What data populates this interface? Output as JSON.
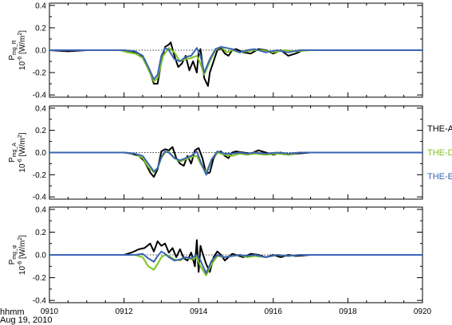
{
  "chart_data": {
    "type": "line",
    "shared_x": {
      "domain": [
        910,
        920
      ],
      "ticks": [
        910,
        912,
        914,
        916,
        918,
        920
      ],
      "tick_labels": [
        "0910",
        "0912",
        "0914",
        "0916",
        "0918",
        "0920"
      ],
      "corner_label_line1": "hhmm",
      "corner_label_line2": "Aug 19, 2010"
    },
    "legend": [
      {
        "name": "THE-A",
        "color": "#000000"
      },
      {
        "name": "THE-D",
        "color": "#7fc31c"
      },
      {
        "name": "THE-E",
        "color": "#3b64b4"
      }
    ],
    "panels": [
      {
        "ylabel_main": "P",
        "ylabel_sub": "mg_R",
        "yunit": "10",
        "yunit_exp": "-6",
        "yunit_rest": "[W/m",
        "yunit_sq": "2",
        "yunit_end": "]",
        "ylim": [
          -0.42,
          0.42
        ],
        "yticks": [
          -0.4,
          -0.2,
          0.0,
          0.2,
          0.4
        ],
        "ytick_labels": [
          "-0.4",
          "-0.2",
          "0.0",
          "0.2",
          "0.4"
        ],
        "series": [
          {
            "name": "THE-A",
            "x": [
              910,
              910.5,
              911,
              911.5,
              912,
              912.2,
              912.4,
              912.55,
              912.7,
              912.8,
              912.9,
              913,
              913.1,
              913.2,
              913.25,
              913.35,
              913.45,
              913.55,
              913.65,
              913.75,
              913.85,
              913.95,
              914,
              914.05,
              914.15,
              914.25,
              914.3,
              914.4,
              914.5,
              914.6,
              914.7,
              914.8,
              914.9,
              915,
              915.2,
              915.4,
              915.6,
              915.8,
              916,
              916.2,
              916.4,
              916.6,
              916.8,
              917,
              917.5,
              918,
              918.5,
              919,
              919.5,
              920
            ],
            "y": [
              0,
              -0.01,
              0,
              0,
              0,
              -0.01,
              -0.03,
              -0.08,
              -0.2,
              -0.3,
              -0.3,
              -0.1,
              0.03,
              0.05,
              0.07,
              -0.05,
              -0.15,
              -0.12,
              -0.05,
              -0.18,
              -0.1,
              -0.2,
              -0.02,
              0.01,
              -0.25,
              -0.32,
              -0.2,
              -0.1,
              0,
              0.02,
              -0.03,
              -0.05,
              0,
              0.01,
              -0.02,
              -0.03,
              0.01,
              0,
              -0.03,
              0,
              -0.05,
              -0.03,
              0,
              0,
              0,
              0,
              0,
              0,
              0,
              0
            ]
          },
          {
            "name": "THE-D",
            "x": [
              910,
              910.5,
              911,
              911.5,
              911.9,
              912.1,
              912.3,
              912.5,
              912.65,
              912.8,
              912.9,
              913.05,
              913.2,
              913.35,
              913.5,
              913.65,
              913.8,
              913.95,
              914.05,
              914.15,
              914.3,
              914.45,
              914.6,
              914.75,
              914.9,
              915.1,
              915.3,
              915.5,
              915.7,
              916,
              916.3,
              916.6,
              917,
              917.5,
              918,
              918.5,
              919,
              919.5,
              920
            ],
            "y": [
              0,
              0,
              0,
              0,
              0,
              -0.02,
              -0.03,
              -0.07,
              -0.17,
              -0.28,
              -0.25,
              -0.05,
              0.02,
              -0.02,
              -0.1,
              -0.08,
              -0.07,
              -0.05,
              -0.12,
              -0.22,
              -0.1,
              0,
              0.03,
              -0.02,
              0,
              -0.02,
              -0.01,
              0,
              0,
              -0.02,
              0,
              -0.01,
              0,
              0,
              0,
              0,
              0,
              0,
              0
            ]
          },
          {
            "name": "THE-E",
            "x": [
              910,
              910.5,
              911,
              911.5,
              912,
              912.3,
              912.5,
              912.65,
              912.8,
              912.9,
              913,
              913.1,
              913.2,
              913.35,
              913.5,
              913.65,
              913.8,
              913.95,
              914.05,
              914.15,
              914.3,
              914.45,
              914.6,
              914.75,
              914.9,
              915.1,
              915.3,
              915.5,
              915.8,
              916.1,
              916.4,
              916.7,
              917,
              917.5,
              918,
              918.5,
              919,
              919.5,
              920
            ],
            "y": [
              0,
              0,
              0,
              0,
              0,
              -0.01,
              -0.05,
              -0.15,
              -0.26,
              -0.22,
              -0.05,
              0.02,
              0,
              -0.08,
              -0.1,
              -0.06,
              -0.05,
              0.02,
              -0.05,
              -0.2,
              -0.08,
              0.01,
              0.03,
              0.02,
              0.01,
              -0.02,
              0,
              0.01,
              -0.02,
              0,
              -0.02,
              0,
              0,
              0,
              0,
              0,
              0,
              0,
              0
            ]
          }
        ]
      },
      {
        "ylabel_main": "P",
        "ylabel_sub": "mg_A",
        "yunit": "10",
        "yunit_exp": "-6",
        "yunit_rest": "[W/m",
        "yunit_sq": "2",
        "yunit_end": "]",
        "ylim": [
          -0.42,
          0.42
        ],
        "yticks": [
          -0.4,
          -0.2,
          0.0,
          0.2,
          0.4
        ],
        "ytick_labels": [
          "-0.4",
          "-0.2",
          "0.0",
          "0.2",
          "0.4"
        ],
        "series": [
          {
            "name": "THE-A",
            "x": [
              910,
              910.5,
              911,
              911.5,
              912,
              912.2,
              912.4,
              912.55,
              912.7,
              912.8,
              912.9,
              913,
              913.1,
              913.2,
              913.3,
              913.4,
              913.5,
              913.6,
              913.7,
              913.8,
              913.9,
              914,
              914.1,
              914.2,
              914.3,
              914.4,
              914.5,
              914.6,
              914.7,
              914.8,
              914.9,
              915,
              915.2,
              915.4,
              915.6,
              915.8,
              916,
              916.2,
              916.4,
              916.6,
              917,
              917.5,
              918,
              918.5,
              919,
              919.5,
              920
            ],
            "y": [
              0,
              0,
              0,
              0,
              0,
              -0.01,
              -0.03,
              -0.08,
              -0.18,
              -0.22,
              -0.15,
              0.01,
              0.03,
              0.02,
              0.05,
              -0.05,
              -0.1,
              -0.12,
              -0.03,
              -0.1,
              0.02,
              0.04,
              -0.05,
              -0.19,
              -0.18,
              -0.05,
              0,
              0.01,
              -0.03,
              -0.05,
              0,
              0.01,
              0,
              -0.01,
              0.02,
              0,
              -0.02,
              0,
              -0.02,
              -0.01,
              0,
              0,
              0,
              0,
              0,
              0,
              0
            ]
          },
          {
            "name": "THE-D",
            "x": [
              910,
              910.5,
              911,
              911.5,
              912,
              912.3,
              912.5,
              912.65,
              912.8,
              912.9,
              913,
              913.1,
              913.2,
              913.35,
              913.5,
              913.65,
              913.8,
              913.95,
              914.05,
              914.2,
              914.35,
              914.5,
              914.7,
              914.9,
              915.1,
              915.3,
              915.5,
              915.8,
              916.1,
              916.4,
              916.7,
              917,
              917.5,
              918,
              918.5,
              919,
              919.5,
              920
            ],
            "y": [
              0,
              0,
              0,
              0,
              0,
              -0.01,
              -0.05,
              -0.13,
              -0.18,
              -0.14,
              -0.05,
              0,
              0.01,
              -0.05,
              -0.08,
              -0.06,
              -0.04,
              -0.03,
              -0.1,
              -0.18,
              -0.06,
              0,
              -0.02,
              -0.03,
              -0.01,
              -0.02,
              -0.01,
              -0.02,
              -0.01,
              -0.02,
              0,
              0,
              0,
              0,
              0,
              0,
              0,
              0
            ]
          },
          {
            "name": "THE-E",
            "x": [
              910,
              910.5,
              911,
              911.5,
              912,
              912.3,
              912.5,
              912.65,
              912.8,
              912.9,
              913,
              913.1,
              913.2,
              913.35,
              913.5,
              913.65,
              913.8,
              913.95,
              914.05,
              914.2,
              914.35,
              914.5,
              914.7,
              914.9,
              915.1,
              915.3,
              915.5,
              915.8,
              916.1,
              916.4,
              916.7,
              917,
              917.5,
              918,
              918.5,
              919,
              919.5,
              920
            ],
            "y": [
              0,
              0,
              0,
              0,
              0,
              -0.01,
              -0.03,
              -0.1,
              -0.17,
              -0.14,
              -0.04,
              0.01,
              0,
              -0.05,
              -0.07,
              -0.05,
              -0.03,
              0.01,
              -0.08,
              -0.2,
              -0.06,
              0.01,
              -0.01,
              -0.01,
              0,
              -0.01,
              0,
              -0.01,
              0,
              -0.01,
              0,
              0,
              0,
              0,
              0,
              0,
              0,
              0
            ]
          }
        ]
      },
      {
        "ylabel_main": "P",
        "ylabel_sub": "mg_φ",
        "yunit": "10",
        "yunit_exp": "-6",
        "yunit_rest": "[W/m",
        "yunit_sq": "2",
        "yunit_end": "]",
        "ylim": [
          -0.42,
          0.42
        ],
        "yticks": [
          -0.4,
          -0.2,
          0.0,
          0.2,
          0.4
        ],
        "ytick_labels": [
          "-0.4",
          "-0.2",
          "0.0",
          "0.2",
          "0.4"
        ],
        "series": [
          {
            "name": "THE-A",
            "x": [
              910,
              910.5,
              911,
              911.5,
              912,
              912.2,
              912.4,
              912.55,
              912.7,
              912.8,
              912.9,
              913,
              913.1,
              913.2,
              913.3,
              913.4,
              913.5,
              913.6,
              913.7,
              913.8,
              913.9,
              913.95,
              914,
              914.05,
              914.1,
              914.2,
              914.3,
              914.4,
              914.5,
              914.6,
              914.7,
              914.8,
              914.9,
              915,
              915.2,
              915.4,
              915.6,
              915.8,
              916,
              916.2,
              916.4,
              916.6,
              917,
              917.5,
              918,
              918.5,
              919,
              919.5,
              920
            ],
            "y": [
              0,
              0,
              0,
              0,
              0,
              0.02,
              0.05,
              0.06,
              0.1,
              0.03,
              0.12,
              0.08,
              0.1,
              0.02,
              0.06,
              -0.02,
              0.05,
              -0.03,
              -0.05,
              0.02,
              -0.1,
              0.13,
              -0.15,
              0.08,
              0.02,
              -0.08,
              -0.15,
              -0.02,
              0.03,
              0,
              -0.05,
              -0.02,
              0.01,
              0,
              -0.02,
              0.01,
              0,
              -0.02,
              0,
              -0.02,
              0,
              -0.01,
              0,
              0,
              0,
              0,
              0,
              0,
              0
            ]
          },
          {
            "name": "THE-D",
            "x": [
              910,
              910.5,
              911,
              911.5,
              912,
              912.3,
              912.5,
              912.65,
              912.8,
              912.9,
              913,
              913.1,
              913.2,
              913.35,
              913.5,
              913.65,
              913.8,
              913.95,
              914.05,
              914.2,
              914.35,
              914.5,
              914.7,
              914.9,
              915.1,
              915.3,
              915.5,
              915.8,
              916.1,
              916.4,
              916.7,
              917,
              917.5,
              918,
              918.5,
              919,
              919.5,
              920
            ],
            "y": [
              0,
              0,
              0,
              0,
              0,
              0,
              -0.02,
              -0.1,
              -0.13,
              -0.08,
              -0.02,
              0,
              -0.01,
              -0.04,
              -0.05,
              -0.02,
              -0.04,
              -0.02,
              -0.1,
              -0.18,
              -0.08,
              -0.01,
              -0.02,
              -0.01,
              0,
              -0.02,
              -0.01,
              -0.02,
              0,
              -0.01,
              0,
              0,
              0,
              0,
              0,
              0,
              0,
              0
            ]
          },
          {
            "name": "THE-E",
            "x": [
              910,
              910.5,
              911,
              911.5,
              912,
              912.3,
              912.5,
              912.65,
              912.8,
              912.9,
              913,
              913.1,
              913.2,
              913.35,
              913.5,
              913.65,
              913.8,
              913.95,
              914.05,
              914.2,
              914.35,
              914.5,
              914.7,
              914.9,
              915.1,
              915.3,
              915.5,
              915.8,
              916.1,
              916.4,
              916.7,
              917,
              917.5,
              918,
              918.5,
              919,
              919.5,
              920
            ],
            "y": [
              0,
              0,
              0,
              0,
              0,
              0,
              0.01,
              -0.03,
              -0.06,
              -0.01,
              0.03,
              0.01,
              -0.02,
              -0.05,
              -0.04,
              -0.02,
              -0.03,
              0,
              -0.05,
              -0.16,
              -0.05,
              0,
              -0.02,
              -0.01,
              0,
              -0.01,
              0,
              -0.02,
              0,
              -0.01,
              0,
              0,
              0,
              0,
              0,
              0,
              0,
              0
            ]
          }
        ]
      }
    ]
  }
}
